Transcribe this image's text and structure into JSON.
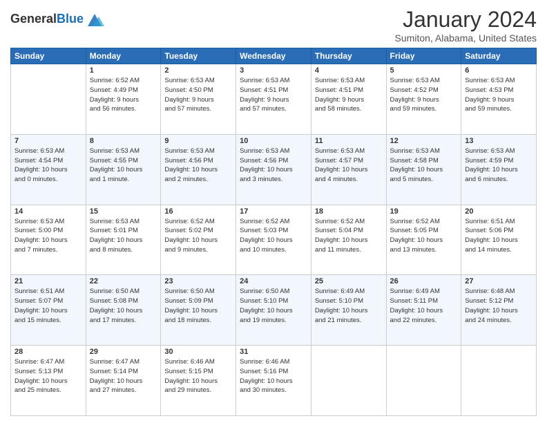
{
  "app": {
    "logo_general": "General",
    "logo_blue": "Blue",
    "month_title": "January 2024",
    "subtitle": "Sumiton, Alabama, United States"
  },
  "calendar": {
    "headers": [
      "Sunday",
      "Monday",
      "Tuesday",
      "Wednesday",
      "Thursday",
      "Friday",
      "Saturday"
    ],
    "weeks": [
      [
        {
          "day": "",
          "info": ""
        },
        {
          "day": "1",
          "info": "Sunrise: 6:52 AM\nSunset: 4:49 PM\nDaylight: 9 hours\nand 56 minutes."
        },
        {
          "day": "2",
          "info": "Sunrise: 6:53 AM\nSunset: 4:50 PM\nDaylight: 9 hours\nand 57 minutes."
        },
        {
          "day": "3",
          "info": "Sunrise: 6:53 AM\nSunset: 4:51 PM\nDaylight: 9 hours\nand 57 minutes."
        },
        {
          "day": "4",
          "info": "Sunrise: 6:53 AM\nSunset: 4:51 PM\nDaylight: 9 hours\nand 58 minutes."
        },
        {
          "day": "5",
          "info": "Sunrise: 6:53 AM\nSunset: 4:52 PM\nDaylight: 9 hours\nand 59 minutes."
        },
        {
          "day": "6",
          "info": "Sunrise: 6:53 AM\nSunset: 4:53 PM\nDaylight: 9 hours\nand 59 minutes."
        }
      ],
      [
        {
          "day": "7",
          "info": "Sunrise: 6:53 AM\nSunset: 4:54 PM\nDaylight: 10 hours\nand 0 minutes."
        },
        {
          "day": "8",
          "info": "Sunrise: 6:53 AM\nSunset: 4:55 PM\nDaylight: 10 hours\nand 1 minute."
        },
        {
          "day": "9",
          "info": "Sunrise: 6:53 AM\nSunset: 4:56 PM\nDaylight: 10 hours\nand 2 minutes."
        },
        {
          "day": "10",
          "info": "Sunrise: 6:53 AM\nSunset: 4:56 PM\nDaylight: 10 hours\nand 3 minutes."
        },
        {
          "day": "11",
          "info": "Sunrise: 6:53 AM\nSunset: 4:57 PM\nDaylight: 10 hours\nand 4 minutes."
        },
        {
          "day": "12",
          "info": "Sunrise: 6:53 AM\nSunset: 4:58 PM\nDaylight: 10 hours\nand 5 minutes."
        },
        {
          "day": "13",
          "info": "Sunrise: 6:53 AM\nSunset: 4:59 PM\nDaylight: 10 hours\nand 6 minutes."
        }
      ],
      [
        {
          "day": "14",
          "info": "Sunrise: 6:53 AM\nSunset: 5:00 PM\nDaylight: 10 hours\nand 7 minutes."
        },
        {
          "day": "15",
          "info": "Sunrise: 6:53 AM\nSunset: 5:01 PM\nDaylight: 10 hours\nand 8 minutes."
        },
        {
          "day": "16",
          "info": "Sunrise: 6:52 AM\nSunset: 5:02 PM\nDaylight: 10 hours\nand 9 minutes."
        },
        {
          "day": "17",
          "info": "Sunrise: 6:52 AM\nSunset: 5:03 PM\nDaylight: 10 hours\nand 10 minutes."
        },
        {
          "day": "18",
          "info": "Sunrise: 6:52 AM\nSunset: 5:04 PM\nDaylight: 10 hours\nand 11 minutes."
        },
        {
          "day": "19",
          "info": "Sunrise: 6:52 AM\nSunset: 5:05 PM\nDaylight: 10 hours\nand 13 minutes."
        },
        {
          "day": "20",
          "info": "Sunrise: 6:51 AM\nSunset: 5:06 PM\nDaylight: 10 hours\nand 14 minutes."
        }
      ],
      [
        {
          "day": "21",
          "info": "Sunrise: 6:51 AM\nSunset: 5:07 PM\nDaylight: 10 hours\nand 15 minutes."
        },
        {
          "day": "22",
          "info": "Sunrise: 6:50 AM\nSunset: 5:08 PM\nDaylight: 10 hours\nand 17 minutes."
        },
        {
          "day": "23",
          "info": "Sunrise: 6:50 AM\nSunset: 5:09 PM\nDaylight: 10 hours\nand 18 minutes."
        },
        {
          "day": "24",
          "info": "Sunrise: 6:50 AM\nSunset: 5:10 PM\nDaylight: 10 hours\nand 19 minutes."
        },
        {
          "day": "25",
          "info": "Sunrise: 6:49 AM\nSunset: 5:10 PM\nDaylight: 10 hours\nand 21 minutes."
        },
        {
          "day": "26",
          "info": "Sunrise: 6:49 AM\nSunset: 5:11 PM\nDaylight: 10 hours\nand 22 minutes."
        },
        {
          "day": "27",
          "info": "Sunrise: 6:48 AM\nSunset: 5:12 PM\nDaylight: 10 hours\nand 24 minutes."
        }
      ],
      [
        {
          "day": "28",
          "info": "Sunrise: 6:47 AM\nSunset: 5:13 PM\nDaylight: 10 hours\nand 25 minutes."
        },
        {
          "day": "29",
          "info": "Sunrise: 6:47 AM\nSunset: 5:14 PM\nDaylight: 10 hours\nand 27 minutes."
        },
        {
          "day": "30",
          "info": "Sunrise: 6:46 AM\nSunset: 5:15 PM\nDaylight: 10 hours\nand 29 minutes."
        },
        {
          "day": "31",
          "info": "Sunrise: 6:46 AM\nSunset: 5:16 PM\nDaylight: 10 hours\nand 30 minutes."
        },
        {
          "day": "",
          "info": ""
        },
        {
          "day": "",
          "info": ""
        },
        {
          "day": "",
          "info": ""
        }
      ]
    ]
  }
}
